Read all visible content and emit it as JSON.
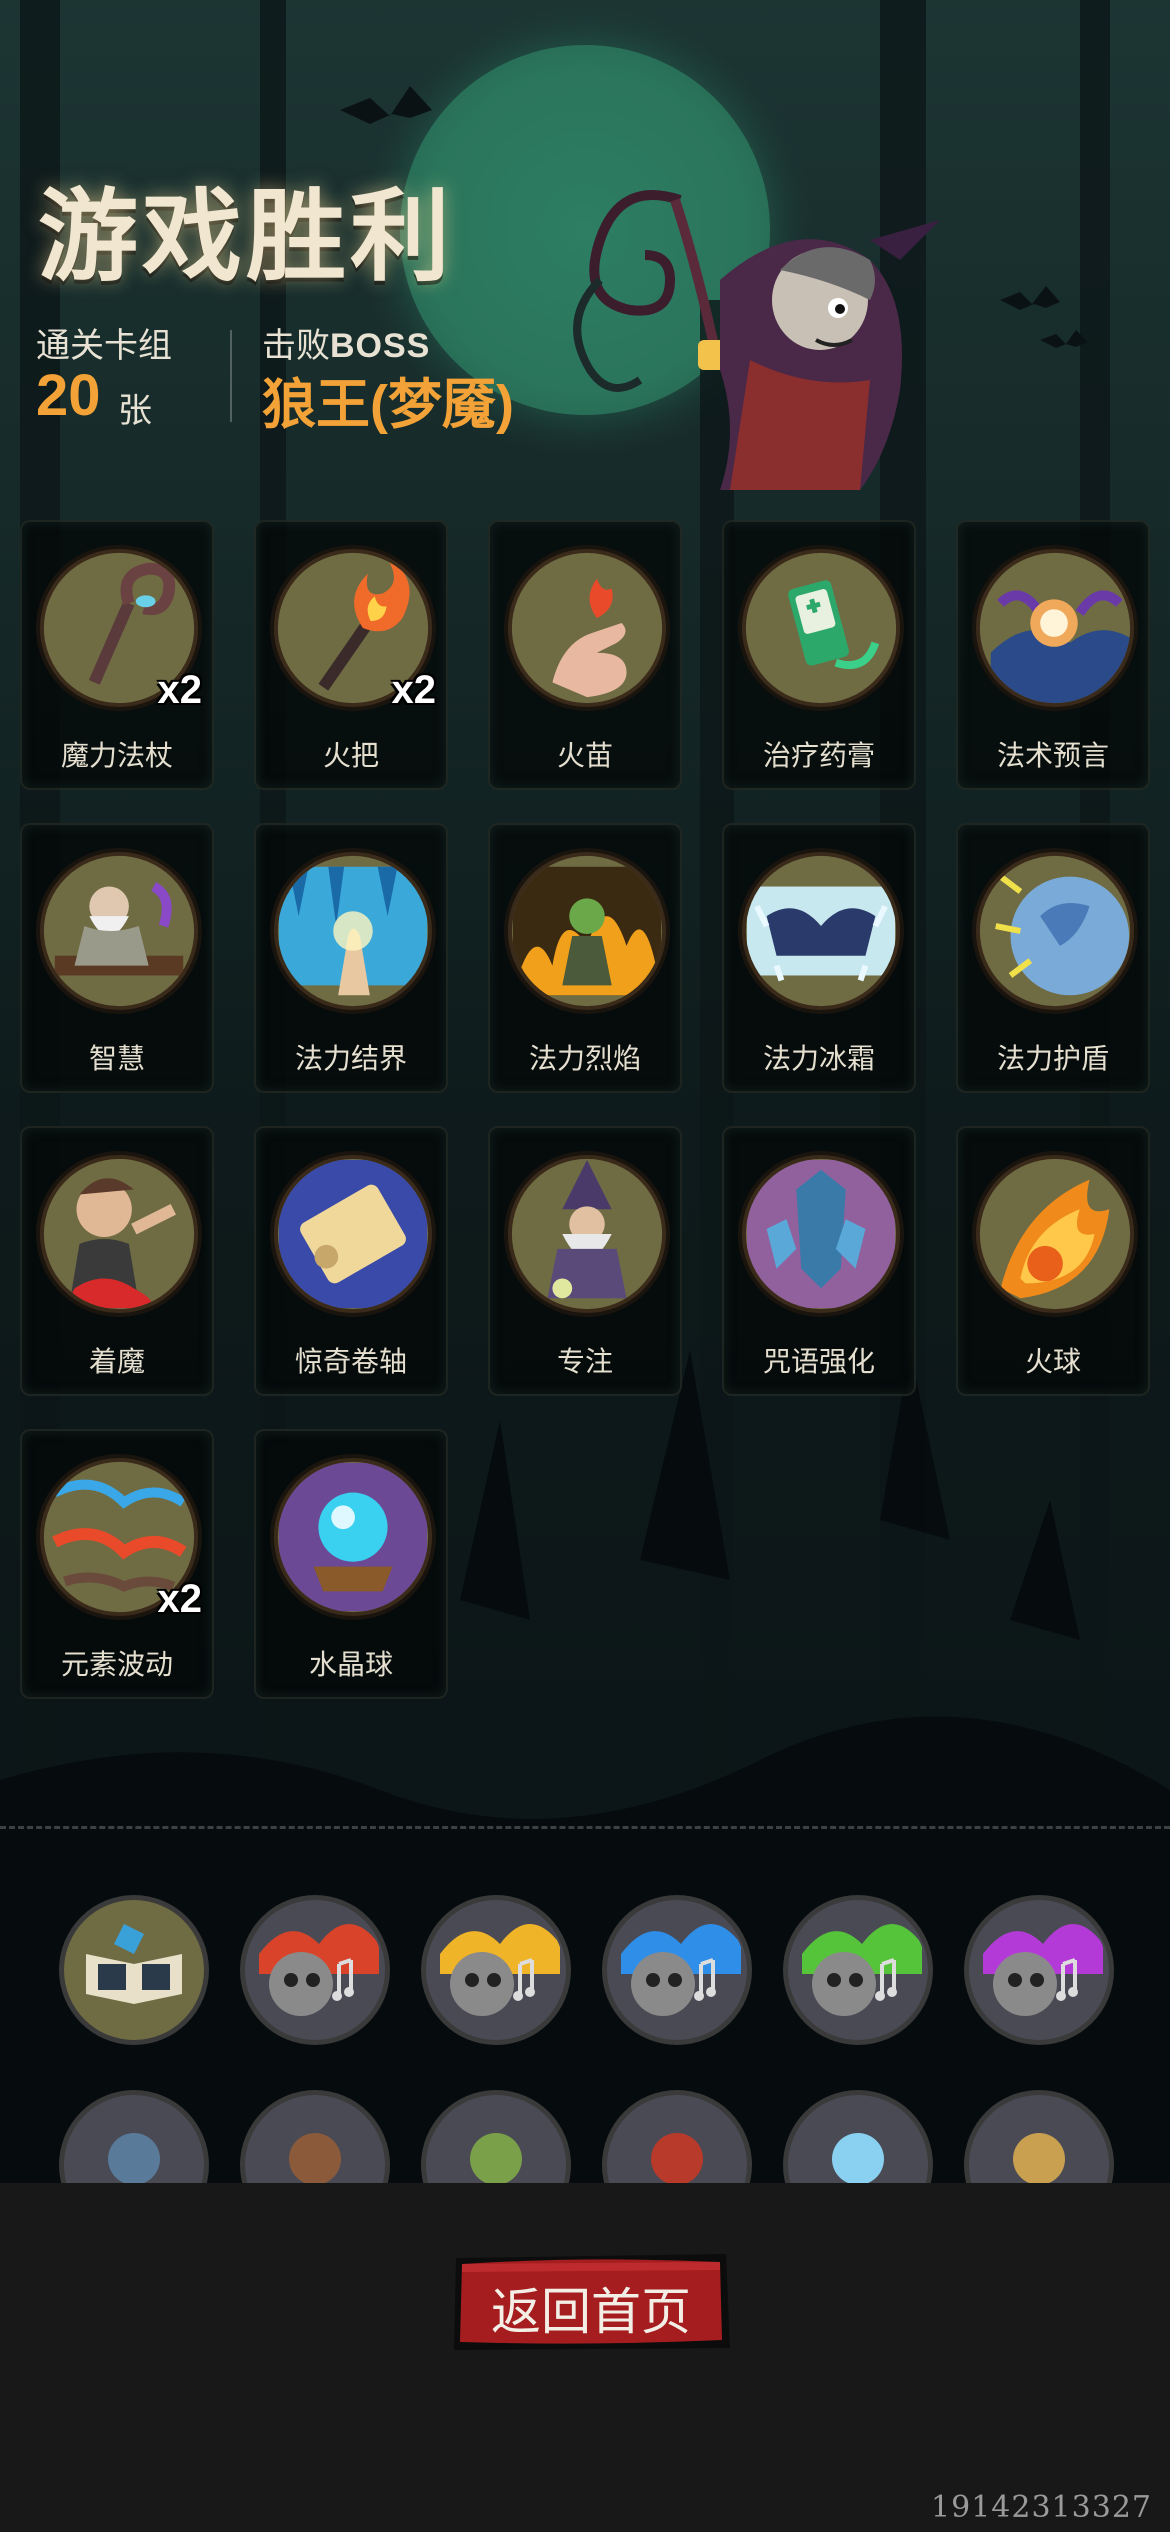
{
  "header": {
    "title": "游戏胜利",
    "deck_label": "通关卡组",
    "deck_count": "20",
    "deck_unit": "张",
    "boss_label_prefix": "击败",
    "boss_label_suffix": "BOSS",
    "boss_name": "狼王(梦魇)"
  },
  "cards": [
    {
      "name": "魔力法杖",
      "count": "x2",
      "icon": "staff-icon"
    },
    {
      "name": "火把",
      "count": "x2",
      "icon": "torch-icon"
    },
    {
      "name": "火苗",
      "count": "",
      "icon": "flame-fingers-icon"
    },
    {
      "name": "治疗药膏",
      "count": "",
      "icon": "ointment-tube-icon"
    },
    {
      "name": "法术预言",
      "count": "",
      "icon": "crystal-orb-hands-icon"
    },
    {
      "name": "智慧",
      "count": "",
      "icon": "old-sage-icon"
    },
    {
      "name": "法力结界",
      "count": "",
      "icon": "ice-barrier-hand-icon"
    },
    {
      "name": "法力烈焰",
      "count": "",
      "icon": "fire-zombie-icon"
    },
    {
      "name": "法力冰霜",
      "count": "",
      "icon": "frozen-hands-icon"
    },
    {
      "name": "法力护盾",
      "count": "",
      "icon": "planet-shield-icon"
    },
    {
      "name": "着魔",
      "count": "",
      "icon": "possessed-man-icon"
    },
    {
      "name": "惊奇卷轴",
      "count": "",
      "icon": "scroll-icon"
    },
    {
      "name": "专注",
      "count": "",
      "icon": "wizard-icon"
    },
    {
      "name": "咒语强化",
      "count": "",
      "icon": "crystal-shards-icon"
    },
    {
      "name": "火球",
      "count": "",
      "icon": "fireball-icon"
    },
    {
      "name": "元素波动",
      "count": "x2",
      "icon": "elemental-wave-icon"
    },
    {
      "name": "水晶球",
      "count": "",
      "icon": "crystal-ball-icon"
    }
  ],
  "relics_row1": [
    {
      "icon": "spellbook-relic-icon",
      "tint": "#3aa0d8"
    },
    {
      "icon": "red-skull-music-relic-icon",
      "tint": "#d8432a"
    },
    {
      "icon": "yellow-skull-music-relic-icon",
      "tint": "#f0b428"
    },
    {
      "icon": "blue-skull-music-relic-icon",
      "tint": "#2f8ee8"
    },
    {
      "icon": "green-skull-music-relic-icon",
      "tint": "#56c43a"
    },
    {
      "icon": "purple-skull-music-relic-icon",
      "tint": "#b43ad8"
    }
  ],
  "relics_row2": [
    {
      "icon": "bearded-wizard-relic-icon",
      "tint": "#5a7a9a"
    },
    {
      "icon": "hooded-figure-relic-icon",
      "tint": "#8a5a3a"
    },
    {
      "icon": "goblin-ghost-relic-icon",
      "tint": "#7aa04a"
    },
    {
      "icon": "crossed-axes-relic-icon",
      "tint": "#b83a2a"
    },
    {
      "icon": "ice-cross-relic-icon",
      "tint": "#8ad0f0"
    },
    {
      "icon": "samurai-relic-icon",
      "tint": "#c8a050"
    }
  ],
  "footer": {
    "home_button_label": "返回首页",
    "build_id": "19142313327"
  },
  "colors": {
    "accent_orange": "#f2a237",
    "card_disc": "#6f6c44",
    "button_red": "#a51d1f"
  }
}
